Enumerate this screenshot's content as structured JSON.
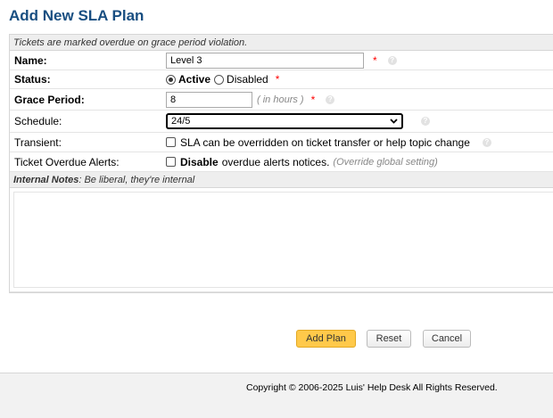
{
  "page": {
    "title": "Add New SLA Plan"
  },
  "form": {
    "intro": "Tickets are marked overdue on grace period violation.",
    "name_label": "Name:",
    "name_value": "Level 3",
    "status_label": "Status:",
    "status_active": "Active",
    "status_disabled": "Disabled",
    "status_selected": "Active",
    "grace_label": "Grace Period:",
    "grace_value": "8",
    "grace_hint": "( in hours )",
    "schedule_label": "Schedule:",
    "schedule_value": "24/5",
    "transient_label": "Transient:",
    "transient_text": "SLA can be overridden on ticket transfer or help topic change",
    "alerts_label": "Ticket Overdue Alerts:",
    "alerts_bold": "Disable",
    "alerts_text": "overdue alerts notices.",
    "alerts_hint": "(Override global setting)",
    "required_mark": "*",
    "notes_heading_bold": "Internal Notes",
    "notes_heading_rest": ": Be liberal, they're internal",
    "notes_value": ""
  },
  "buttons": {
    "add": "Add Plan",
    "reset": "Reset",
    "cancel": "Cancel"
  },
  "footer": {
    "copyright": "Copyright © 2006-2025 Luis' Help Desk All Rights Reserved."
  },
  "colors": {
    "title": "#184e81",
    "primary_button": "#ffc94a",
    "required": "#ff0000"
  }
}
